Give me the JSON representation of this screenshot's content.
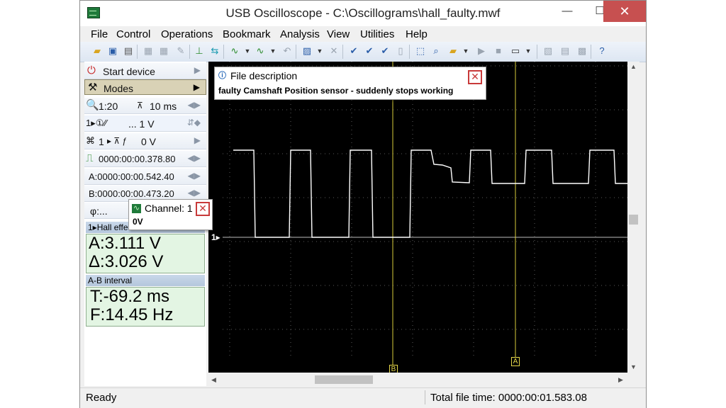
{
  "window": {
    "title": "USB Oscilloscope - C:\\Oscillograms\\hall_faulty.mwf",
    "min_glyph": "—",
    "max_glyph": "☐",
    "close_glyph": "✕"
  },
  "menu": [
    "File",
    "Control",
    "Operations",
    "Bookmark",
    "Analysis",
    "View",
    "Utilities",
    "Help"
  ],
  "toolbar_icons": [
    "open-icon",
    "save-icon",
    "print-icon",
    "copy-icon",
    "paste-icon",
    "brush-icon",
    "cursor-icon",
    "channel-icon",
    "signal-icon",
    "signal2-icon",
    "undo-icon",
    "measure-icon",
    "delete-icon",
    "check-icon",
    "check2-icon",
    "check3-icon",
    "page-icon",
    "select-icon",
    "zoom-icon",
    "bookmark-icon",
    "play-icon",
    "stop-icon",
    "display-icon",
    "image-icon",
    "doc-icon",
    "close-doc-icon",
    "help-icon"
  ],
  "left_panel": {
    "start_device": "Start device",
    "modes": "Modes",
    "zoom": "1:20",
    "timebase": "10 ms",
    "channel_volts": "... 1 V",
    "trigger_channel": "1",
    "trigger_level": "0 V",
    "trigger_time": "0000:00:00.378.80",
    "cursor_a": "A:0000:00:00.542.40",
    "cursor_b": "B:0000:00:00.473.20",
    "phi": "φ:...",
    "channel_head": "1▸Hall effect s..."
  },
  "measurements": {
    "a_value": "A:3.111 V",
    "delta_value": "Δ:3.026 V",
    "interval_head": "A-B interval",
    "period": "T:-69.2 ms",
    "frequency": "F:14.45 Hz"
  },
  "channel_popup": {
    "title": "Channel: 1",
    "body": "0V"
  },
  "file_popup": {
    "title": "File description",
    "body": "faulty Camshaft Position sensor - suddenly stops working"
  },
  "scope": {
    "channel_marker": "1▸",
    "cursor_b_label": "B",
    "cursor_a_label": "A",
    "trace_color": "#ffffff",
    "grid_color": "#5a5a5a",
    "cursor_color": "#d8cc3a"
  },
  "status": {
    "ready": "Ready",
    "file_time": "Total file time: 0000:00:01.583.08"
  }
}
